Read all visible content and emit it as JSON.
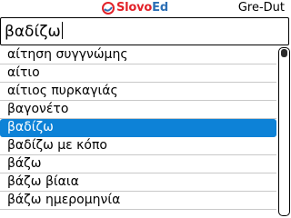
{
  "header": {
    "logo": {
      "text_slovo": "Slovo",
      "text_ed": "Ed",
      "icon": "slovoed-logo-icon"
    },
    "language_pair": "Gre-Dut"
  },
  "search": {
    "value": "βαδίζω"
  },
  "word_list": {
    "items": [
      "αίτηση συγγνώμης",
      "αίτιο",
      "αίτιος πυρκαγιάς",
      "βαγονέτο",
      "βαδίζω",
      "βαδίζω με κόπο",
      "βάζω",
      "βάζω βίαια",
      "βάζω ημερομηνία"
    ],
    "selected_index": 4
  },
  "scrollbar": {
    "position_fraction": 0.0
  },
  "colors": {
    "selection": "#0d82d7",
    "logo_red": "#e2232a",
    "logo_blue": "#2c6fb5"
  }
}
